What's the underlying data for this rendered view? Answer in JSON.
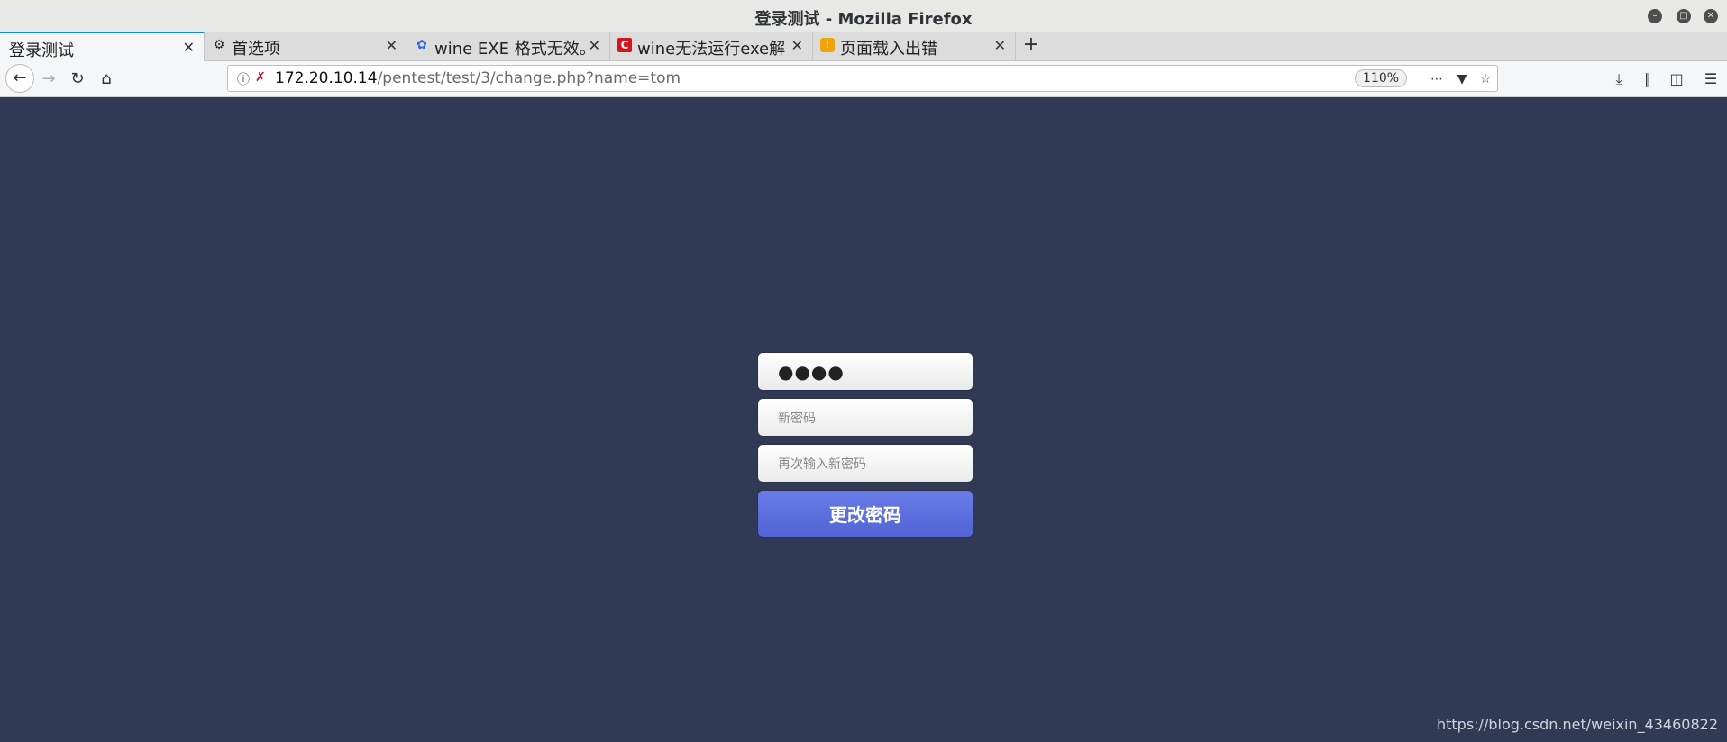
{
  "window": {
    "title": "登录测试 - Mozilla Firefox"
  },
  "tabs": [
    {
      "label": "登录测试",
      "icon": "none",
      "active": true
    },
    {
      "label": "首选项",
      "icon": "gear-icon",
      "active": false
    },
    {
      "label": "wine EXE 格式无效。",
      "icon": "baidu-paw-icon",
      "active": false
    },
    {
      "label": "wine无法运行exe解",
      "icon": "csdn-icon",
      "active": false
    },
    {
      "label": "页面载入出错",
      "icon": "warning-icon",
      "active": false
    }
  ],
  "nav": {
    "url_host": "172.20.10.14",
    "url_path": "/pentest/test/3/change.php?name=tom",
    "zoom": "110%"
  },
  "form": {
    "current_password_masked": "●●●●",
    "new_password_placeholder": "新密码",
    "confirm_password_placeholder": "再次输入新密码",
    "submit_label": "更改密码"
  },
  "watermark": "https://blog.csdn.net/weixin_43460822",
  "colors": {
    "page_background": "#313a55",
    "button": "#5a6ce0",
    "tab_accent": "#0a84ff"
  }
}
